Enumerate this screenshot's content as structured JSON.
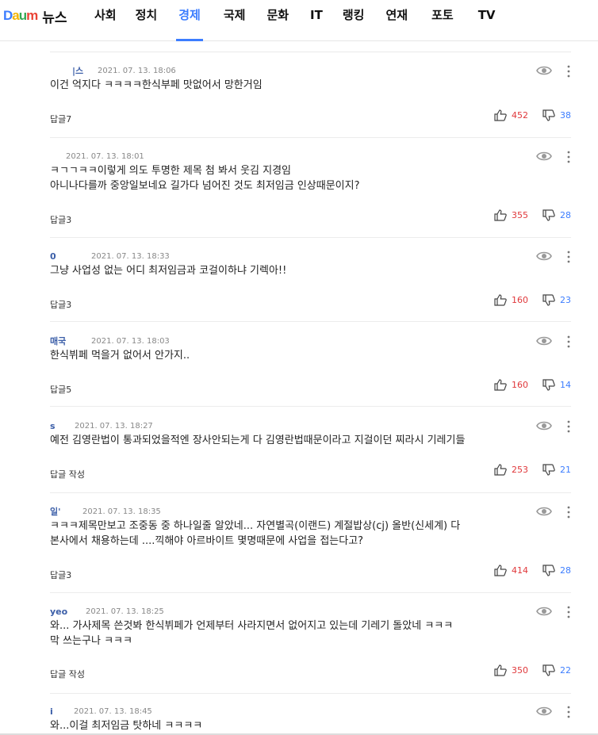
{
  "header": {
    "logo_letters": [
      "D",
      "a",
      "u",
      "m"
    ],
    "logo_colors": [
      "#3c7dff",
      "#f4b400",
      "#34a853",
      "#ea4335"
    ],
    "service": "뉴스",
    "menu": [
      {
        "label": "사회",
        "active": false
      },
      {
        "label": "정치",
        "active": false
      },
      {
        "label": "경제",
        "active": true
      },
      {
        "label": "국제",
        "active": false
      },
      {
        "label": "문화",
        "active": false
      },
      {
        "label": "IT",
        "active": false
      },
      {
        "label": "랭킹",
        "active": false
      },
      {
        "label": "연재",
        "active": false
      },
      {
        "label": "포토",
        "active": false
      },
      {
        "label": "TV",
        "active": false
      }
    ]
  },
  "comments": [
    {
      "nick": "|스",
      "date": "2021. 07. 13. 18:06",
      "text": "이건 억지다 ㅋㅋㅋㅋ한식부페 맛없어서 망한거임",
      "reply": "답글7",
      "likes": "452",
      "dislikes": "38"
    },
    {
      "nick": "",
      "date": "2021. 07. 13. 18:01",
      "text": "ㅋㄱㄱㅋㅋ이렇게 의도 투명한 제목 첨 봐서 웃김 지경임\n아니나다를까 중앙일보네요 길가다 넘어진 것도 최저임금 인상때문이지?",
      "reply": "답글3",
      "likes": "355",
      "dislikes": "28"
    },
    {
      "nick": "0",
      "date": "2021. 07. 13. 18:33",
      "text": "그냥 사업성 없는 어디 최저임금과 코걸이하냐 기렉아!!",
      "reply": "답글3",
      "likes": "160",
      "dislikes": "23"
    },
    {
      "nick": "매국",
      "date": "2021. 07. 13. 18:03",
      "text": "한식뷔페 먹을거 없어서 안가지..",
      "reply": "답글5",
      "likes": "160",
      "dislikes": "14"
    },
    {
      "nick": "s",
      "date": "2021. 07. 13. 18:27",
      "text": "예전 김영란법이 통과되었을적엔  장사안되는게 다 김영란법때문이라고 지걸이던 찌라시 기레기들",
      "reply": "답글 작성",
      "likes": "253",
      "dislikes": "21"
    },
    {
      "nick": "일'",
      "date": "2021. 07. 13. 18:35",
      "text": "ㅋㅋㅋ제목만보고 조중동 중 하나일줄 알았네...  자연별곡(이랜드) 계절밥상(cj) 올반(신세계) 다\n본사에서 채용하는데 ....끽해야 아르바이트 몇명때문에 사업을 접는다고?",
      "reply": "답글3",
      "likes": "414",
      "dislikes": "28"
    },
    {
      "nick": "yeo",
      "date": "2021. 07. 13. 18:25",
      "text": "와...  가사제목 쓴것봐   한식뷔페가  언제부터  사라지면서  없어지고 있는데  기레기  돌았네 ㅋㅋㅋ\n막 쓰는구나 ㅋㅋㅋ",
      "reply": "답글 작성",
      "likes": "350",
      "dislikes": "22"
    },
    {
      "nick": "i",
      "date": "2021. 07. 13. 18:45",
      "text": "와...이걸 최저임금 탓하네 ㅋㅋㅋㅋ",
      "reply": "",
      "likes": "",
      "dislikes": ""
    }
  ],
  "colors": {
    "accent": "#3c7dff",
    "like": "#e0383b",
    "dislike": "#3c7dff"
  }
}
